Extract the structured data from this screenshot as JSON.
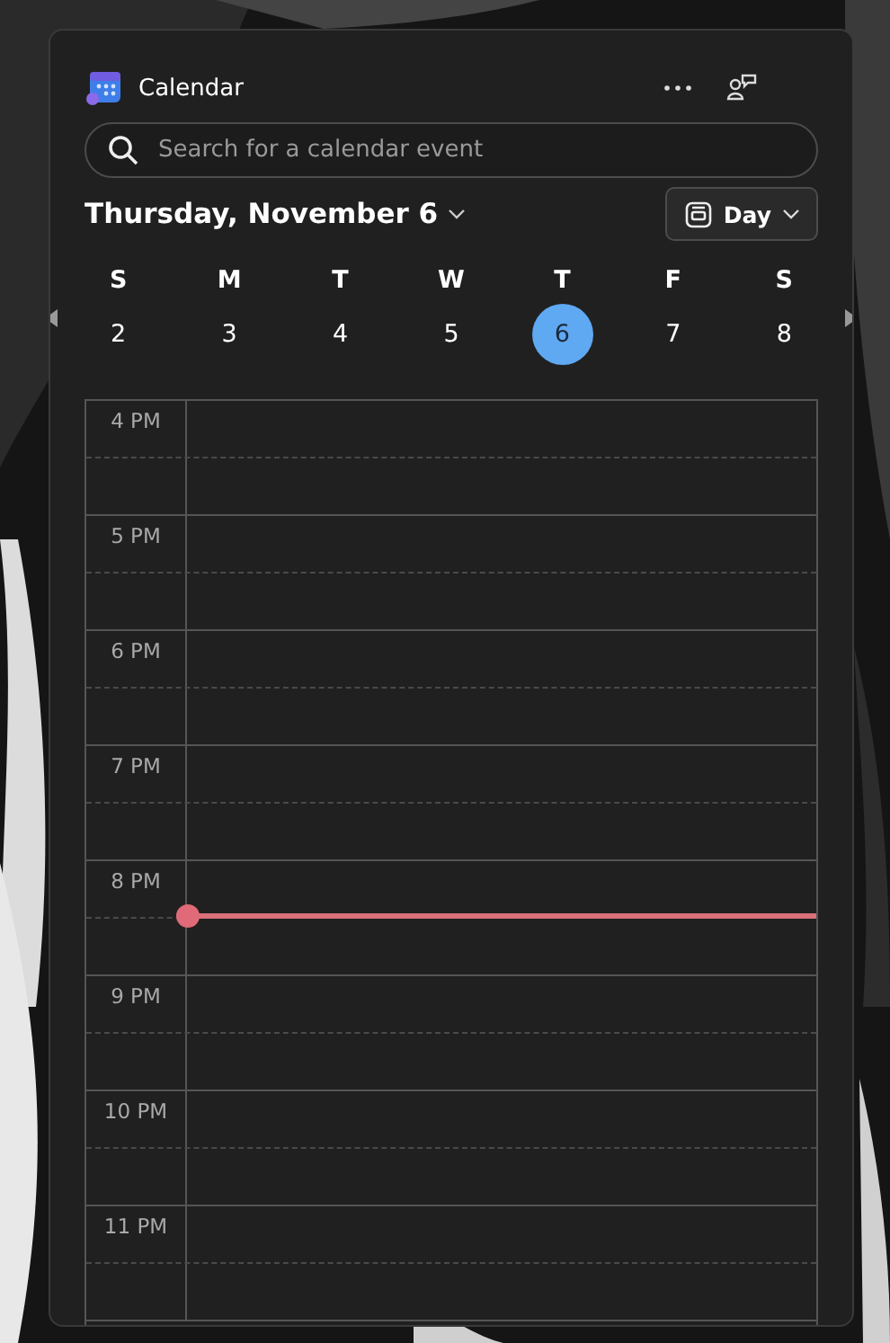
{
  "widget": {
    "title": "Calendar"
  },
  "search": {
    "placeholder": "Search for a calendar event"
  },
  "date_heading": "Thursday, November 6",
  "view_button": {
    "label": "Day"
  },
  "week": [
    {
      "weekday": "S",
      "day": "2",
      "selected": false
    },
    {
      "weekday": "M",
      "day": "3",
      "selected": false
    },
    {
      "weekday": "T",
      "day": "4",
      "selected": false
    },
    {
      "weekday": "W",
      "day": "5",
      "selected": false
    },
    {
      "weekday": "T",
      "day": "6",
      "selected": true
    },
    {
      "weekday": "F",
      "day": "7",
      "selected": false
    },
    {
      "weekday": "S",
      "day": "8",
      "selected": false
    }
  ],
  "hours": [
    {
      "label": "4 PM",
      "now": false
    },
    {
      "label": "5 PM",
      "now": false
    },
    {
      "label": "6 PM",
      "now": false
    },
    {
      "label": "7 PM",
      "now": false
    },
    {
      "label": "8 PM",
      "now": true
    },
    {
      "label": "9 PM",
      "now": false
    },
    {
      "label": "10 PM",
      "now": false
    },
    {
      "label": "11 PM",
      "now": false
    }
  ]
}
